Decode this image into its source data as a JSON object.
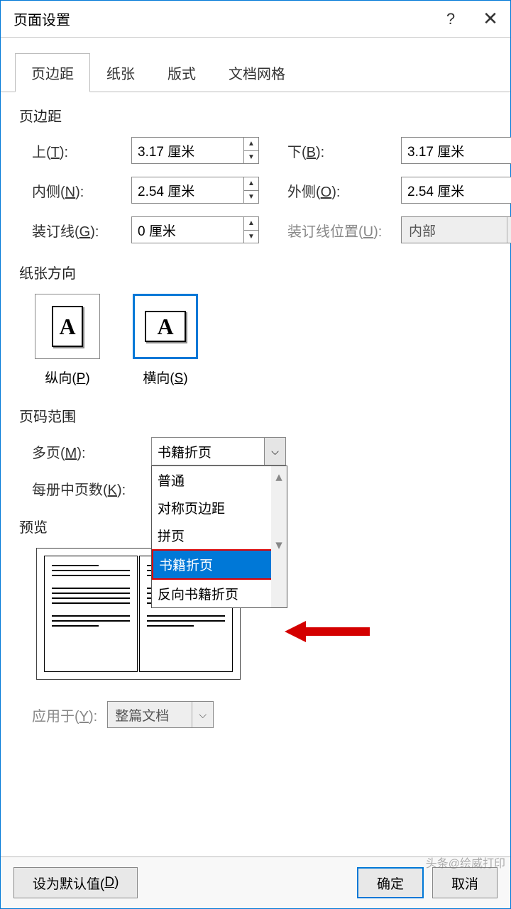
{
  "titlebar": {
    "title": "页面设置",
    "help": "?",
    "close": "✕"
  },
  "tabs": [
    "页边距",
    "纸张",
    "版式",
    "文档网格"
  ],
  "margins": {
    "title": "页边距",
    "top": {
      "label": "上(T):",
      "value": "3.17 厘米"
    },
    "bottom": {
      "label": "下(B):",
      "value": "3.17 厘米"
    },
    "inside": {
      "label": "内侧(N):",
      "value": "2.54 厘米"
    },
    "outside": {
      "label": "外侧(O):",
      "value": "2.54 厘米"
    },
    "gutter": {
      "label": "装订线(G):",
      "value": "0 厘米"
    },
    "gutterpos": {
      "label": "装订线位置(U):",
      "value": "内部"
    }
  },
  "orientation": {
    "title": "纸张方向",
    "portrait": "纵向(P)",
    "landscape": "横向(S)"
  },
  "pagerange": {
    "title": "页码范围",
    "multi": {
      "label": "多页(M):",
      "value": "书籍折页"
    },
    "sheets": {
      "label": "每册中页数(K):"
    },
    "options": [
      "普通",
      "对称页边距",
      "拼页",
      "书籍折页",
      "反向书籍折页"
    ]
  },
  "preview": {
    "title": "预览"
  },
  "applyto": {
    "label": "应用于(Y):",
    "value": "整篇文档"
  },
  "buttons": {
    "default": "设为默认值(D)",
    "ok": "确定",
    "cancel": "取消"
  },
  "watermark": "头条@绘威打印"
}
